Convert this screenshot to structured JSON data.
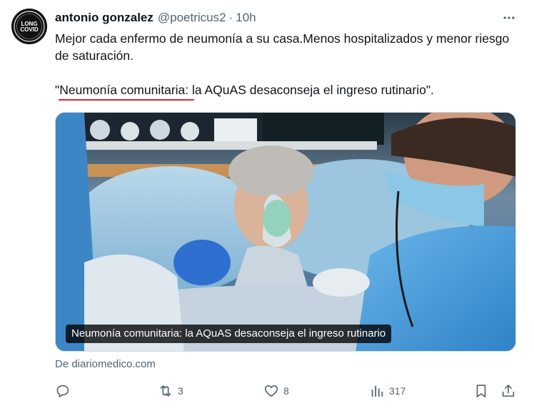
{
  "author": {
    "name": "antonio gonzalez",
    "handle": "@poetricus2",
    "separator": "·",
    "time": "10h",
    "avatar_text_top": "LONG",
    "avatar_text_bottom": "COVID"
  },
  "tweet": {
    "line1": "Mejor cada enfermo de neumonía a su casa.Menos hospitalizados y menor riesgo de saturación.",
    "quote": "\"Neumonía comunitaria: la AQuAS desaconseja el ingreso rutinario\".",
    "highlight_color": "#e0202a"
  },
  "card": {
    "caption": "Neumonía comunitaria: la AQuAS desaconseja el ingreso rutinario",
    "source": "De diariomedico.com"
  },
  "actions": {
    "reply_count": "",
    "retweet_count": "3",
    "like_count": "8",
    "views_count": "317"
  },
  "icons": [
    "more-icon",
    "reply-icon",
    "retweet-icon",
    "like-icon",
    "views-icon",
    "bookmark-icon",
    "share-icon"
  ],
  "colors": {
    "text": "#0f1419",
    "secondary": "#536471",
    "border": "#cfd9de"
  }
}
